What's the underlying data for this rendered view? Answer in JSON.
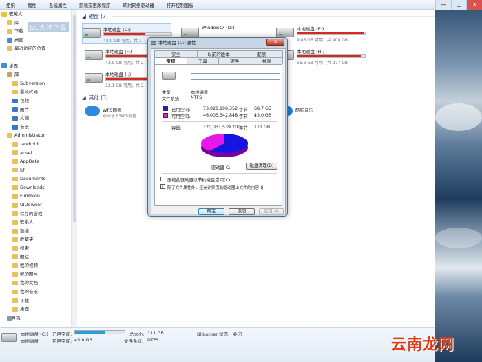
{
  "menubar": [
    "组织",
    "属性",
    "系统属性",
    "卸载或更改程序",
    "映射网络驱动器",
    "打开控制面板"
  ],
  "window_buttons": [
    "—",
    "□",
    "✕"
  ],
  "nav": {
    "items": [
      {
        "label": "收藏夹",
        "icon": "star-icon",
        "level": 0
      },
      {
        "label": "库",
        "icon": "folder-icon",
        "level": 1
      },
      {
        "label": "下载",
        "icon": "download-folder-icon",
        "level": 1
      },
      {
        "label": "桌面",
        "icon": "desktop-icon",
        "level": 1
      },
      {
        "label": "最近访问的位置",
        "icon": "recent-places-icon",
        "level": 1
      },
      {
        "label": "",
        "icon": "",
        "level": 0
      },
      {
        "label": "桌面",
        "icon": "desktop-icon",
        "level": 0
      },
      {
        "label": "库",
        "icon": "library-icon",
        "level": 1
      },
      {
        "label": "Subversion",
        "icon": "folder-icon",
        "level": 2
      },
      {
        "label": "暴风转码",
        "icon": "folder-icon",
        "level": 2
      },
      {
        "label": "视频",
        "icon": "video-library-icon",
        "level": 2
      },
      {
        "label": "图片",
        "icon": "pictures-library-icon",
        "level": 2
      },
      {
        "label": "文档",
        "icon": "documents-library-icon",
        "level": 2
      },
      {
        "label": "音乐",
        "icon": "music-library-icon",
        "level": 2
      },
      {
        "label": "Administrator",
        "icon": "user-folder-icon",
        "level": 1
      },
      {
        "label": ".android",
        "icon": "folder-icon",
        "level": 2
      },
      {
        "label": "ansel",
        "icon": "folder-icon",
        "level": 2
      },
      {
        "label": "AppData",
        "icon": "folder-icon",
        "level": 2
      },
      {
        "label": "bf",
        "icon": "folder-icon",
        "level": 2
      },
      {
        "label": "Documents",
        "icon": "folder-icon",
        "level": 2
      },
      {
        "label": "Downloads",
        "icon": "folder-icon",
        "level": 2
      },
      {
        "label": "Funshion",
        "icon": "folder-icon",
        "level": 2
      },
      {
        "label": "UIDowner",
        "icon": "folder-icon",
        "level": 2
      },
      {
        "label": "保存的游戏",
        "icon": "folder-icon",
        "level": 2
      },
      {
        "label": "联系人",
        "icon": "folder-icon",
        "level": 2
      },
      {
        "label": "链接",
        "icon": "folder-icon",
        "level": 2
      },
      {
        "label": "收藏夹",
        "icon": "folder-icon",
        "level": 2
      },
      {
        "label": "搜索",
        "icon": "folder-icon",
        "level": 2
      },
      {
        "label": "图标",
        "icon": "folder-icon",
        "level": 2
      },
      {
        "label": "我的视频",
        "icon": "folder-icon",
        "level": 2
      },
      {
        "label": "我的图片",
        "icon": "folder-icon",
        "level": 2
      },
      {
        "label": "我的文档",
        "icon": "folder-icon",
        "level": 2
      },
      {
        "label": "我的音乐",
        "icon": "folder-icon",
        "level": 2
      },
      {
        "label": "下载",
        "icon": "folder-icon",
        "level": 2
      },
      {
        "label": "桌面",
        "icon": "folder-icon",
        "level": 2
      },
      {
        "label": "计算机",
        "icon": "computer-icon",
        "level": 1
      }
    ]
  },
  "content": {
    "hard_disks_header": "硬盘 (7)",
    "other_header": "其他 (3)",
    "drives": [
      {
        "name": "本地磁盘 (C:)",
        "free": "43.0 GB 可用，共 1",
        "used_fraction": 0.61,
        "selected": true
      },
      {
        "name": "Windows7 (D:)",
        "free": "",
        "used_fraction": 0.5,
        "selected": false
      },
      {
        "name": "本地磁盘 (E:)",
        "free": "9.86 GB 可用，共 900 GB",
        "used_fraction": 0.99,
        "selected": false
      },
      {
        "name": "本地磁盘 (F:)",
        "free": "43.9 GB 可用，共 2",
        "used_fraction": 0.82,
        "selected": false
      },
      {
        "name": "本地磁盘 (H:)",
        "free": "16.6 GB 可用，共 277 GB",
        "used_fraction": 0.94,
        "selected": false
      },
      {
        "name": "本地磁盘 (I:)",
        "free": "12.1 GB 可用，共 2",
        "used_fraction": 0.95,
        "selected": false
      }
    ],
    "apps": [
      {
        "name": "WPS网盘",
        "desc": "双击进入WPS网盘",
        "icon": "cloud-drive-icon"
      },
      {
        "name": "酷狗音乐",
        "desc": "",
        "icon": "kugou-music-icon"
      }
    ],
    "watermark": "DL大神下载"
  },
  "statusbar": {
    "name": "本地磁盘 (C:)",
    "used_label": "已用空间:",
    "free_label": "可用空间:",
    "free_value": "43.0 GB",
    "used_fraction": 0.61,
    "total_label": "总大小:",
    "total_value": "111 GB",
    "fs_label": "文件系统:",
    "fs_value": "NTFS",
    "bitlocker_label": "BitLocker 状态:",
    "bitlocker_value": "关闭"
  },
  "dialog": {
    "title": "本地磁盘 (C:) 属性",
    "close": "✕",
    "tabs_row1": [
      "安全",
      "以前的版本",
      "配额"
    ],
    "tabs_row2": [
      "常规",
      "工具",
      "硬件",
      "共享"
    ],
    "name_value": "",
    "type_label": "类型:",
    "type_value": "本地磁盘",
    "fs_label": "文件系统:",
    "fs_value": "NTFS",
    "used_label": "已用空间:",
    "used_bytes": "73,028,196,352",
    "used_unit": "字节",
    "used_gb": "68.7 GB",
    "free_label": "可用空间:",
    "free_bytes": "46,003,342,848",
    "free_unit": "字节",
    "free_gb": "43.0 GB",
    "capacity_label": "容量:",
    "capacity_bytes": "120,031,539,200",
    "capacity_unit": "字节",
    "capacity_gb": "111 GB",
    "drive_label": "驱动器 C:",
    "cleanup_button": "磁盘清理(D)",
    "compress_label": "压缩此驱动器以节约磁盘空间(C)",
    "index_label": "除了文件属性外，还允许索引此驱动器上文件的内容(I)",
    "ok": "确定",
    "cancel": "取消",
    "apply": "应用(A)",
    "used_color": "#1515e0",
    "free_color": "#e818e8"
  },
  "logo": "云南龙网"
}
